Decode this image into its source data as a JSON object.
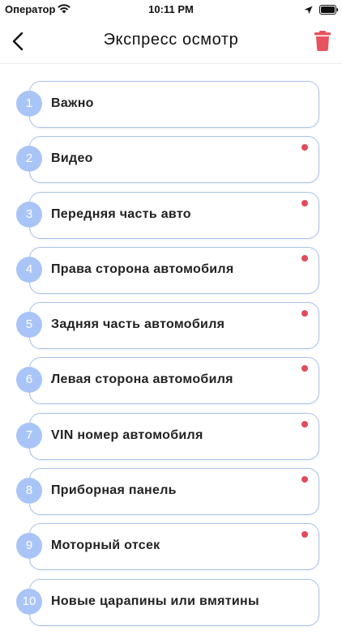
{
  "status_bar": {
    "carrier": "Оператор",
    "time": "10:11 PM"
  },
  "header": {
    "title": "Экспресс осмотр"
  },
  "colors": {
    "accent_number": "#a9c5f7",
    "card_border": "#a9c2ea",
    "dot": "#e24b5b",
    "trash": "#e8525e"
  },
  "icons": {
    "back": "chevron-left-icon",
    "delete": "trash-icon"
  },
  "items": [
    {
      "number": "1",
      "label": "Важно",
      "has_dot": false
    },
    {
      "number": "2",
      "label": "Видео",
      "has_dot": true
    },
    {
      "number": "3",
      "label": "Передняя часть авто",
      "has_dot": true
    },
    {
      "number": "4",
      "label": "Права сторона автомобиля",
      "has_dot": true
    },
    {
      "number": "5",
      "label": "Задняя часть автомобиля",
      "has_dot": true
    },
    {
      "number": "6",
      "label": "Левая сторона автомобиля",
      "has_dot": true
    },
    {
      "number": "7",
      "label": "VIN номер автомобиля",
      "has_dot": true
    },
    {
      "number": "8",
      "label": "Приборная панель",
      "has_dot": true
    },
    {
      "number": "9",
      "label": "Моторный отсек",
      "has_dot": true
    },
    {
      "number": "10",
      "label": "Новые царапины или вмятины",
      "has_dot": false
    }
  ]
}
